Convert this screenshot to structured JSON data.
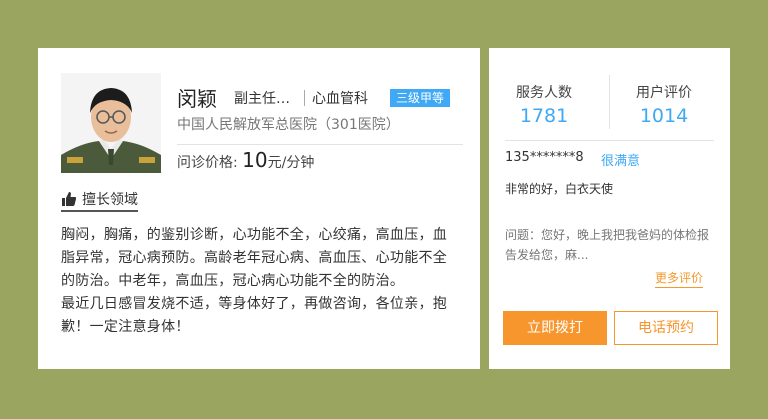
{
  "doctor": {
    "name": "闵颖",
    "title": "副主任…",
    "department": "心血管科",
    "hospital_level": "三级甲等",
    "hospital": "中国人民解放军总医院（301医院）",
    "price_label": "问诊价格:",
    "price_value": "10",
    "price_unit": "元/分钟"
  },
  "specialty": {
    "label": "擅长领域",
    "description": "胸闷，胸痛，的鉴别诊断，心功能不全，心绞痛，高血压，血脂异常，冠心病预防。高龄老年冠心病、高血压、心功能不全的防治。中老年，高血压，冠心病心功能不全的防治。",
    "note": "最近几日感冒发烧不适，等身体好了，再做咨询，各位亲，抱歉！一定注意身体！"
  },
  "stats": {
    "served_label": "服务人数",
    "served_value": "1781",
    "rating_label": "用户评价",
    "rating_value": "1014"
  },
  "review": {
    "user": "135*******8",
    "satisfaction": "很满意",
    "text": "非常的好，白衣天使",
    "question": "问题：您好，晚上我把我爸妈的体检报告发给您，麻...",
    "more_label": "更多评价"
  },
  "actions": {
    "call_label": "立即拨打",
    "book_label": "电话预约"
  },
  "colors": {
    "background": "#9aa55f",
    "accent_blue": "#3fa9f5",
    "accent_orange": "#f6962d"
  },
  "icons": {
    "specialty": "thumbs-up-icon"
  }
}
